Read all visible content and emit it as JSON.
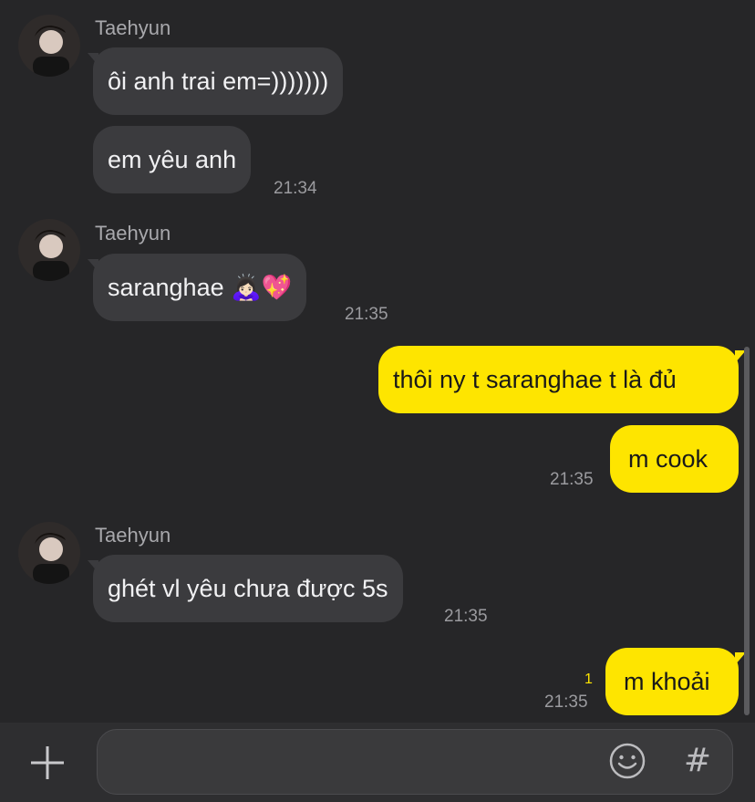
{
  "chat": {
    "messages": [
      {
        "sender": "Taehyun",
        "bubbles": [
          {
            "text": "ôi anh trai em=)))))))"
          },
          {
            "text": "em yêu anh"
          }
        ],
        "time": "21:34"
      },
      {
        "sender": "Taehyun",
        "bubbles": [
          {
            "text": "saranghae 🙇🏻‍♀️💖"
          }
        ],
        "time": "21:35"
      },
      {
        "sender": "me",
        "bubbles": [
          {
            "text": "thôi ny t saranghae t là đủ"
          },
          {
            "text": "m cook"
          }
        ],
        "time": "21:35"
      },
      {
        "sender": "Taehyun",
        "bubbles": [
          {
            "text": "ghét vl yêu chưa được 5s"
          }
        ],
        "time": "21:35"
      },
      {
        "sender": "me",
        "bubbles": [
          {
            "text": "m khoải"
          }
        ],
        "time": "21:35",
        "unread": "1"
      }
    ]
  },
  "composer": {
    "plus_icon": "plus-icon",
    "emoji_icon": "smiley-icon",
    "hash_label": "#"
  },
  "colors": {
    "background": "#262628",
    "incoming_bubble": "#3b3b3e",
    "outgoing_bubble": "#fee500",
    "unread": "#fee500"
  }
}
